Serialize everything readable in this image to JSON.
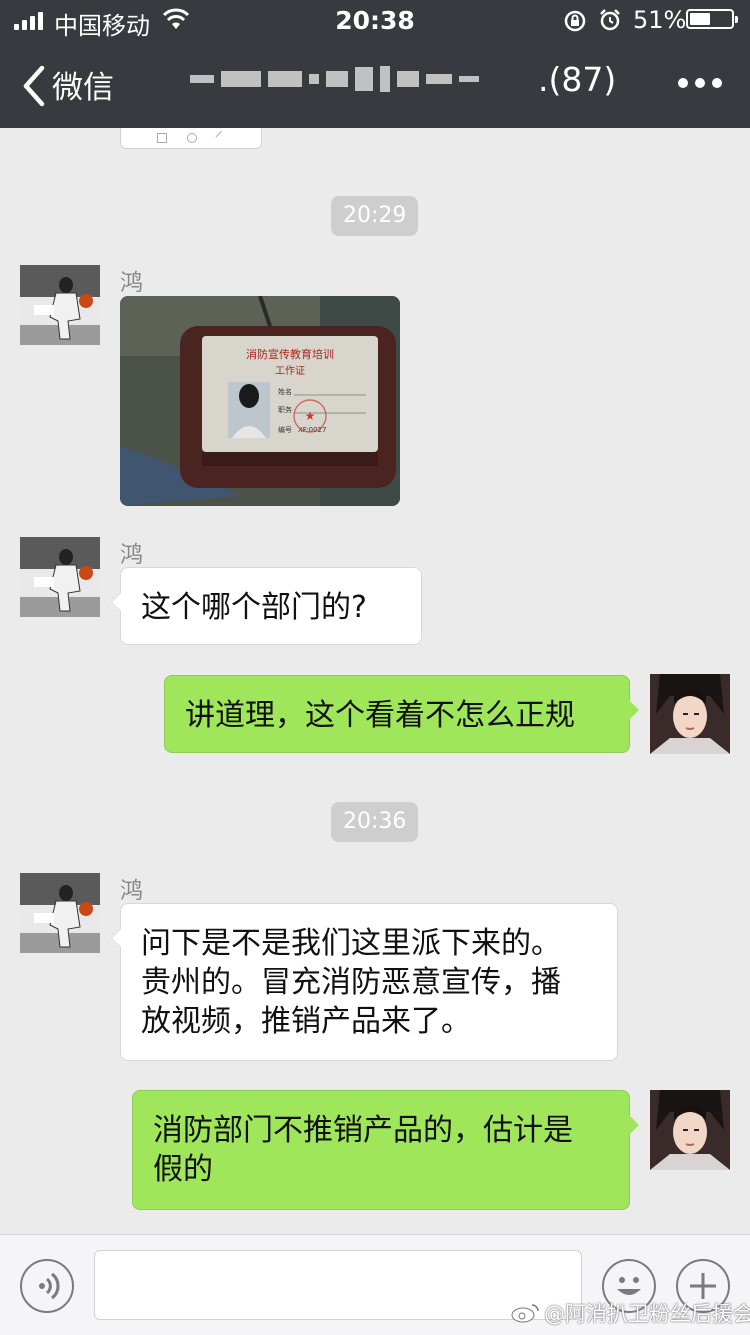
{
  "status_bar": {
    "carrier": "中国移动",
    "time": "20:38",
    "battery_pct": "51%"
  },
  "nav": {
    "back_label": "微信",
    "title_count": ".(87)"
  },
  "messages": {
    "time_1": "20:29",
    "time_2": "20:36",
    "sender_1": "鸿",
    "sender_2": "鸿",
    "sender_3": "鸿",
    "left_1": "这个哪个部门的?",
    "right_1": "讲道理，这个看着不怎么正规",
    "left_2_line1": "问下是不是我们这里派下来的。",
    "left_2_line2": "贵州的。冒充消防恶意宣传，播",
    "left_2_line3": "放视频，推销产品来了。",
    "right_2_line1": "消防部门不推销产品的，估计是",
    "right_2_line2": "假的"
  },
  "id_card": {
    "header": "消防宣传教育培训",
    "subheader": "工作证",
    "field_name": "姓名",
    "field_role": "职务",
    "field_number": "编号",
    "number_value": "XF:0027"
  },
  "watermark": "@阿消扒卫粉丝后援会",
  "icons": {
    "voice": "voice-icon",
    "emoji": "emoji-icon",
    "plus": "plus-icon",
    "more": "more-icon",
    "back": "back-chevron-icon"
  },
  "colors": {
    "topbar": "#393a3f",
    "bubble_right": "#9fe65a",
    "bubble_left": "#ffffff",
    "time_chip": "#cecece"
  }
}
